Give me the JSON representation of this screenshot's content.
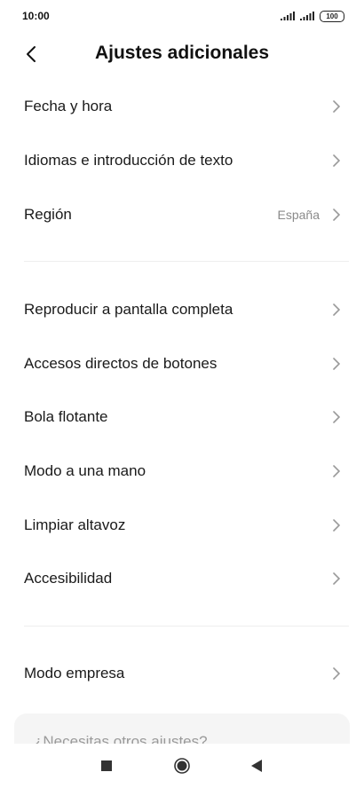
{
  "status_bar": {
    "time": "10:00",
    "battery": "100"
  },
  "header": {
    "title": "Ajustes adicionales",
    "back_icon": "chevron-left-icon"
  },
  "groups": [
    {
      "items": [
        {
          "label": "Fecha y hora",
          "value": ""
        },
        {
          "label": "Idiomas e introducción de texto",
          "value": ""
        },
        {
          "label": "Región",
          "value": "España"
        }
      ]
    },
    {
      "items": [
        {
          "label": "Reproducir a pantalla completa",
          "value": ""
        },
        {
          "label": "Accesos directos de botones",
          "value": ""
        },
        {
          "label": "Bola flotante",
          "value": ""
        },
        {
          "label": "Modo a una mano",
          "value": ""
        },
        {
          "label": "Limpiar altavoz",
          "value": ""
        },
        {
          "label": "Accesibilidad",
          "value": ""
        }
      ]
    },
    {
      "items": [
        {
          "label": "Modo empresa",
          "value": ""
        }
      ]
    }
  ],
  "help_card": {
    "text": "¿Necesitas otros ajustes?"
  },
  "navbar": {
    "icons": [
      "recents-square-icon",
      "home-circle-icon",
      "back-triangle-icon"
    ]
  },
  "colors": {
    "text": "#1a1a1a",
    "secondary_text": "#8a8a8a",
    "chevron": "#9a9a9a",
    "divider": "#eeeeee",
    "card_bg": "#f5f5f5"
  }
}
